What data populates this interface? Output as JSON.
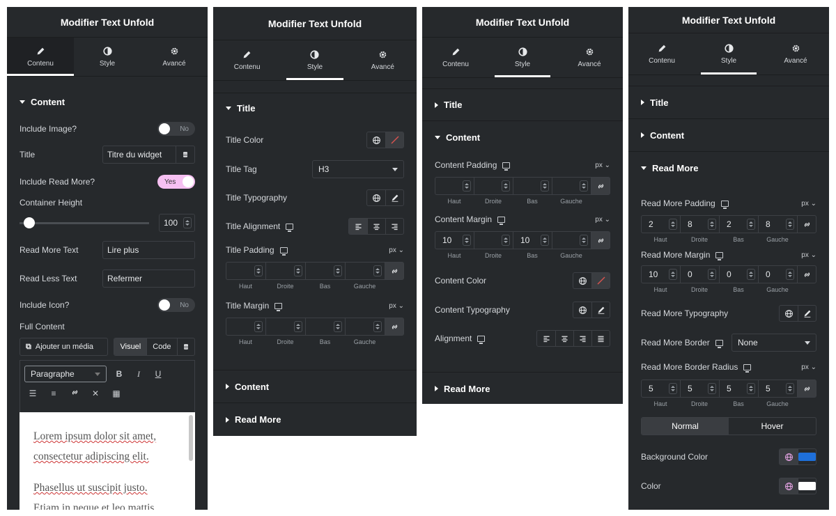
{
  "panel_title": "Modifier Text Unfold",
  "tabs": {
    "content": "Contenu",
    "style": "Style",
    "advanced": "Avancé"
  },
  "panel1": {
    "section": "Content",
    "include_image": {
      "label": "Include Image?",
      "value": "No"
    },
    "title": {
      "label": "Title",
      "value": "Titre du widget"
    },
    "include_read_more": {
      "label": "Include Read More?",
      "value": "Yes"
    },
    "container_height": {
      "label": "Container Height",
      "value": "100"
    },
    "read_more_text": {
      "label": "Read More Text",
      "value": "Lire plus"
    },
    "read_less_text": {
      "label": "Read Less Text",
      "value": "Refermer"
    },
    "include_icon": {
      "label": "Include Icon?",
      "value": "No"
    },
    "full_content": {
      "label": "Full Content"
    },
    "editor": {
      "add_media": "Ajouter un média",
      "visual": "Visuel",
      "code": "Code",
      "format": "Paragraphe",
      "bold": "B",
      "italic": "I",
      "underline": "U",
      "para1_a": "Lorem ipsum dolor sit amet,",
      "para1_b": "consectetur adipiscing elit.",
      "para2_a": "Phasellus ut suscipit justo.",
      "para2_b": "Etiam in neque et leo mattis"
    }
  },
  "panel2": {
    "title_section": "Title",
    "title_color": "Title Color",
    "title_tag": {
      "label": "Title Tag",
      "value": "H3"
    },
    "title_typography": "Title Typography",
    "title_alignment": "Title Alignment",
    "title_padding": "Title Padding",
    "title_margin": "Title Margin",
    "content_section": "Content",
    "read_more_section": "Read More"
  },
  "panel3": {
    "title_section": "Title",
    "content_section": "Content",
    "content_padding": "Content Padding",
    "content_margin": {
      "label": "Content Margin",
      "top": "10",
      "bottom": "10"
    },
    "content_color": "Content Color",
    "content_typography": "Content Typography",
    "alignment": "Alignment",
    "read_more_section": "Read More"
  },
  "panel4": {
    "title_section": "Title",
    "content_section": "Content",
    "read_more_section": "Read More",
    "read_more_padding": {
      "label": "Read More Padding",
      "top": "2",
      "right": "8",
      "bottom": "2",
      "left": "8"
    },
    "read_more_margin": {
      "label": "Read More Margin",
      "top": "10",
      "right": "0",
      "bottom": "0",
      "left": "0"
    },
    "read_more_typography": "Read More Typography",
    "read_more_border": {
      "label": "Read More Border",
      "value": "None"
    },
    "read_more_border_radius": {
      "label": "Read More Border Radius",
      "top": "5",
      "right": "5",
      "bottom": "5",
      "left": "5"
    },
    "normal": "Normal",
    "hover": "Hover",
    "background_color": {
      "label": "Background Color",
      "swatch": "#1e6fd9"
    },
    "color": {
      "label": "Color",
      "swatch": "#ffffff"
    }
  },
  "units": {
    "px": "px"
  },
  "dim_labels": {
    "top": "Haut",
    "right": "Droite",
    "bottom": "Bas",
    "left": "Gauche"
  },
  "colors": {
    "panel_bg": "#26292c",
    "accent_pink": "#f6c0f2",
    "globe_pink": "#e9a6e8"
  }
}
